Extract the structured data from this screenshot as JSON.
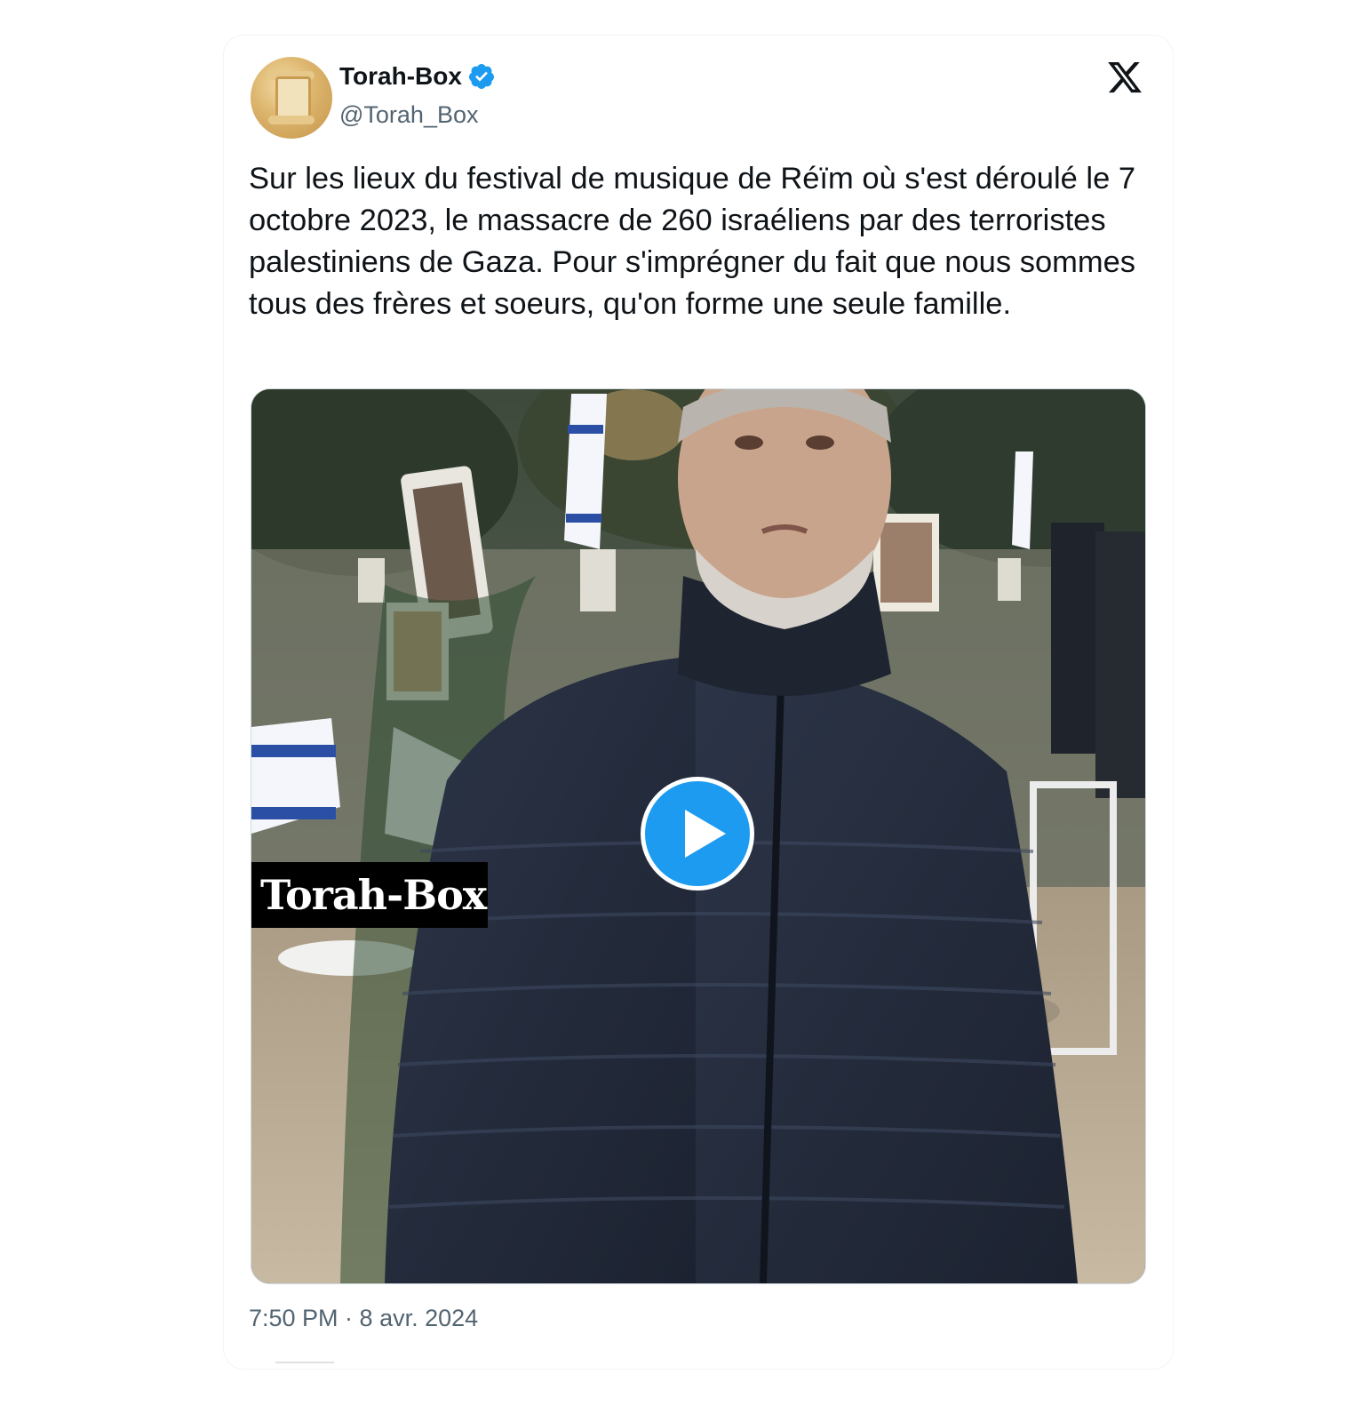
{
  "tweet": {
    "author": {
      "display_name": "Torah-Box",
      "handle": "@Torah_Box",
      "verified": true,
      "avatar_icon": "torah-scroll-icon"
    },
    "platform_icon": "x-logo-icon",
    "text": "Sur les lieux du festival de musique de Réïm où s'est déroulé le 7 octobre 2023, le massacre de 260 israéliens par des terroristes palestiniens de Gaza. Pour s'imprégner du fait que nous sommes tous des frères et soeurs, qu'on forme une seule famille.",
    "media": {
      "type": "video",
      "watermark": "Torah-Box",
      "play_icon": "play-icon"
    },
    "timestamp": "7:50 PM · 8 avr. 2024"
  },
  "colors": {
    "text_primary": "#0f1419",
    "text_secondary": "#536471",
    "accent": "#1d9bf0"
  }
}
